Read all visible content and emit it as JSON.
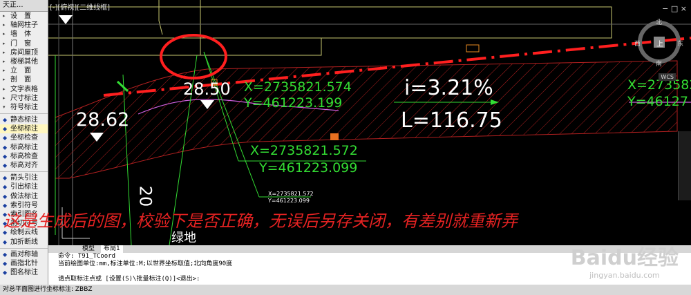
{
  "sidebar": {
    "title": "天正...",
    "items": [
      {
        "label": "设　置",
        "arrow": "▸"
      },
      {
        "label": "轴网柱子",
        "arrow": "▸"
      },
      {
        "label": "墙　体",
        "arrow": "▸"
      },
      {
        "label": "门　窗",
        "arrow": "▸"
      },
      {
        "label": "房间屋顶",
        "arrow": "▸"
      },
      {
        "label": "楼梯其他",
        "arrow": "▸"
      },
      {
        "label": "立　面",
        "arrow": "▸"
      },
      {
        "label": "剖　面",
        "arrow": "▸"
      },
      {
        "label": "文字表格",
        "arrow": "▸"
      },
      {
        "label": "尺寸标注",
        "arrow": "▸"
      },
      {
        "label": "符号标注",
        "arrow": "▾"
      }
    ],
    "tools": [
      {
        "label": "静态标注",
        "icon": "pin-icon"
      },
      {
        "label": "坐标标注",
        "icon": "coordinate-icon"
      },
      {
        "label": "坐标检查",
        "icon": "check-icon"
      },
      {
        "label": "标高标注",
        "icon": "elevation-icon"
      },
      {
        "label": "标高检查",
        "icon": "check-icon"
      },
      {
        "label": "标高对齐",
        "icon": "align-icon"
      },
      {
        "label": "箭头引注",
        "icon": "arrow-icon"
      },
      {
        "label": "引出标注",
        "icon": "leader-icon"
      },
      {
        "label": "做法标注",
        "icon": "method-icon"
      },
      {
        "label": "索引符号",
        "icon": "index-icon"
      },
      {
        "label": "索引图名",
        "icon": "index-icon"
      },
      {
        "label": "剖切符号",
        "icon": "section-icon"
      },
      {
        "label": "绘制云线",
        "icon": "cloud-icon"
      },
      {
        "label": "加折断线",
        "icon": "break-icon"
      },
      {
        "label": "画对称轴",
        "icon": "axis-icon"
      },
      {
        "label": "画指北针",
        "icon": "north-icon"
      },
      {
        "label": "图名标注",
        "icon": "title-icon"
      }
    ]
  },
  "drawing": {
    "tab_title": "[-][俯视][二维线框]",
    "elev_left": "28.62",
    "elev_mid": "28.50",
    "slope": "i=3.21%",
    "length": "L=116.75",
    "coord1": {
      "x": "X=2735821.574",
      "y": "Y=461223.199"
    },
    "coord2": {
      "x": "X=2735821.572",
      "y": "Y=461223.099"
    },
    "coord3": {
      "x": "X=2735821.572",
      "y": "Y=461223.099"
    },
    "coord_right": {
      "x": "X=273582",
      "y": "Y=46127"
    },
    "vertical_label": "20",
    "green_text": "绿地",
    "compass": {
      "n": "北",
      "s": "南",
      "e": "东",
      "w": "西",
      "center": "上",
      "wcs": "WCS"
    }
  },
  "annotation": "这是生成后的图，校验下是否正确，无误后另存关闭，有差别就重新弄",
  "tabs": [
    "模型",
    "布局1"
  ],
  "command": [
    "命令: T91_TCoord",
    "当前绘图单位:mm,标注单位:M;以世界坐标取值;北向角度90度",
    "",
    "请点取标注点或 [设置(S)\\批量标注(Q)]<退出>:"
  ],
  "status": "对总平面图进行坐标标注: ZBBZ",
  "watermark": {
    "brand": "Baidu经验",
    "url": "jingyan.baidu.com"
  },
  "colors": {
    "red": "#ff1f1f",
    "green": "#33dd33",
    "magenta": "#d060e0",
    "white": "#ffffff",
    "yellow": "#e8e800"
  }
}
